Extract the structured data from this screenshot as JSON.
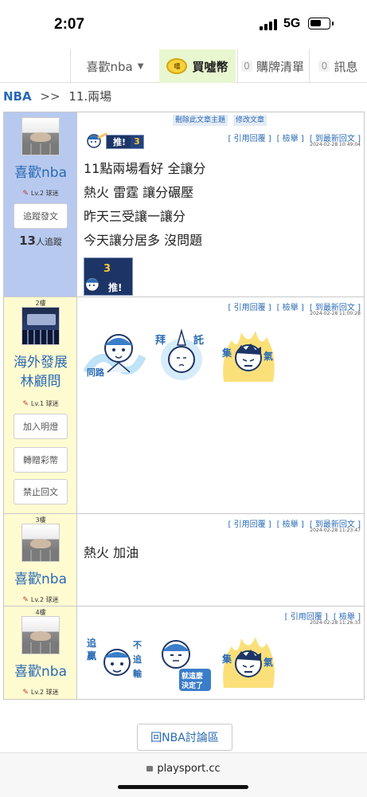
{
  "status": {
    "time": "2:07",
    "network": "5G"
  },
  "nav": {
    "user": "喜歡nba",
    "buy": "買噓幣",
    "coin_label": "嘻",
    "cart_count": "0",
    "cart": "購牌清單",
    "msg_count": "0",
    "msg": "訊息"
  },
  "breadcrumb": {
    "board": "NBA",
    "sep": ">>",
    "title": "11.兩場"
  },
  "admin": {
    "delete": "刪除此文章主題",
    "edit": "修改文章"
  },
  "actions": {
    "quote": "[ 引用回覆 ]",
    "report": "[ 檢舉 ]",
    "latest": "[ 到最新回文 ]"
  },
  "posts": [
    {
      "floor": "",
      "user": "喜歡nba",
      "level": "Lv.2 球迷",
      "follow_btn": "追蹤發文",
      "followers_count": "13",
      "followers_label": "人追蹤",
      "time": "2024-02-28 10:49:04",
      "push_label": "推!",
      "push_count": "3",
      "lines": [
        "11點兩場看好 全讓分",
        "熱火 雷霆 讓分碾壓",
        "昨天三受讓一讓分",
        "今天讓分居多 沒問題"
      ]
    },
    {
      "floor": "2樓",
      "user_line1": "海外發展",
      "user_line2": "林顧問",
      "level": "Lv.1 球迷",
      "btn1": "加入明燈",
      "btn2": "轉贈彩幣",
      "btn3": "禁止回文",
      "time": "2024-02-28 11:00:28",
      "stickers": [
        {
          "text": "同路"
        },
        {
          "text_a": "拜",
          "text_b": "託"
        },
        {
          "text_a": "集",
          "text_b": "氣"
        }
      ]
    },
    {
      "floor": "3樓",
      "user": "喜歡nba",
      "level": "Lv.2 球迷",
      "time": "2024-02-28 11:23:47",
      "text": "熱火 加油"
    },
    {
      "floor": "4樓",
      "user": "喜歡nba",
      "level": "Lv.2 球迷",
      "time": "2024-02-28 11:26:33",
      "stickers": [
        {
          "text_a": "追",
          "text_b": "贏",
          "text_c": "不",
          "text_d": "追",
          "text_e": "輸"
        },
        {
          "text_a": "就這麼",
          "text_b": "決定了"
        },
        {
          "text_a": "集",
          "text_b": "氣"
        }
      ]
    }
  ],
  "footer": {
    "back": "回NBA討論區",
    "url": "playsport.cc"
  },
  "colors": {
    "link": "#2a6ab4",
    "op_sidebar": "#b7c9ef",
    "reply_sidebar": "#fffbd1",
    "buy_bg": "#e9f7d0"
  }
}
